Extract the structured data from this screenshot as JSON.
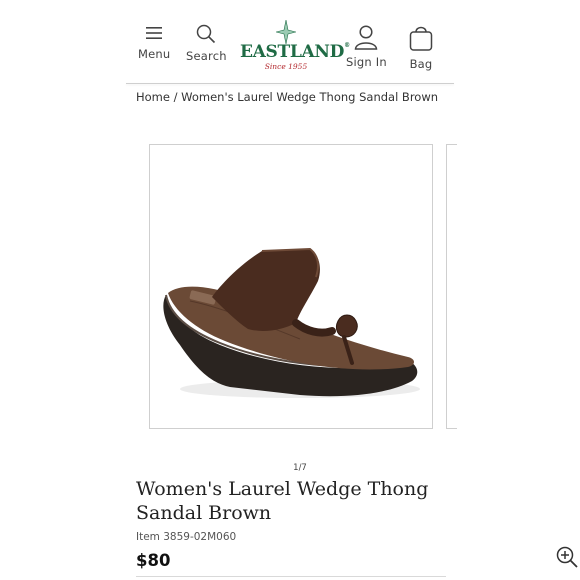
{
  "header": {
    "menu_label": "Menu",
    "search_label": "Search",
    "signin_label": "Sign In",
    "bag_label": "Bag",
    "logo": {
      "wordmark": "EASTLAND",
      "tagline": "Since 1955",
      "trademark": "®"
    }
  },
  "breadcrumb": {
    "home": "Home",
    "separator": "/",
    "current": "Women's Laurel Wedge Thong Sandal Brown"
  },
  "gallery": {
    "counter": "1/7",
    "main_image": "brown-wedge-thong-sandal",
    "zoom_icon": "zoom-in-icon"
  },
  "product": {
    "title": "Women's Laurel Wedge Thong Sandal Brown",
    "item_number": "Item 3859-02M060",
    "price": "$80"
  },
  "colors": {
    "brand_green": "#1f6b45",
    "brand_red": "#b3282d",
    "sandal_brown": "#4a2c1f",
    "sole_dark": "#2a2420"
  }
}
